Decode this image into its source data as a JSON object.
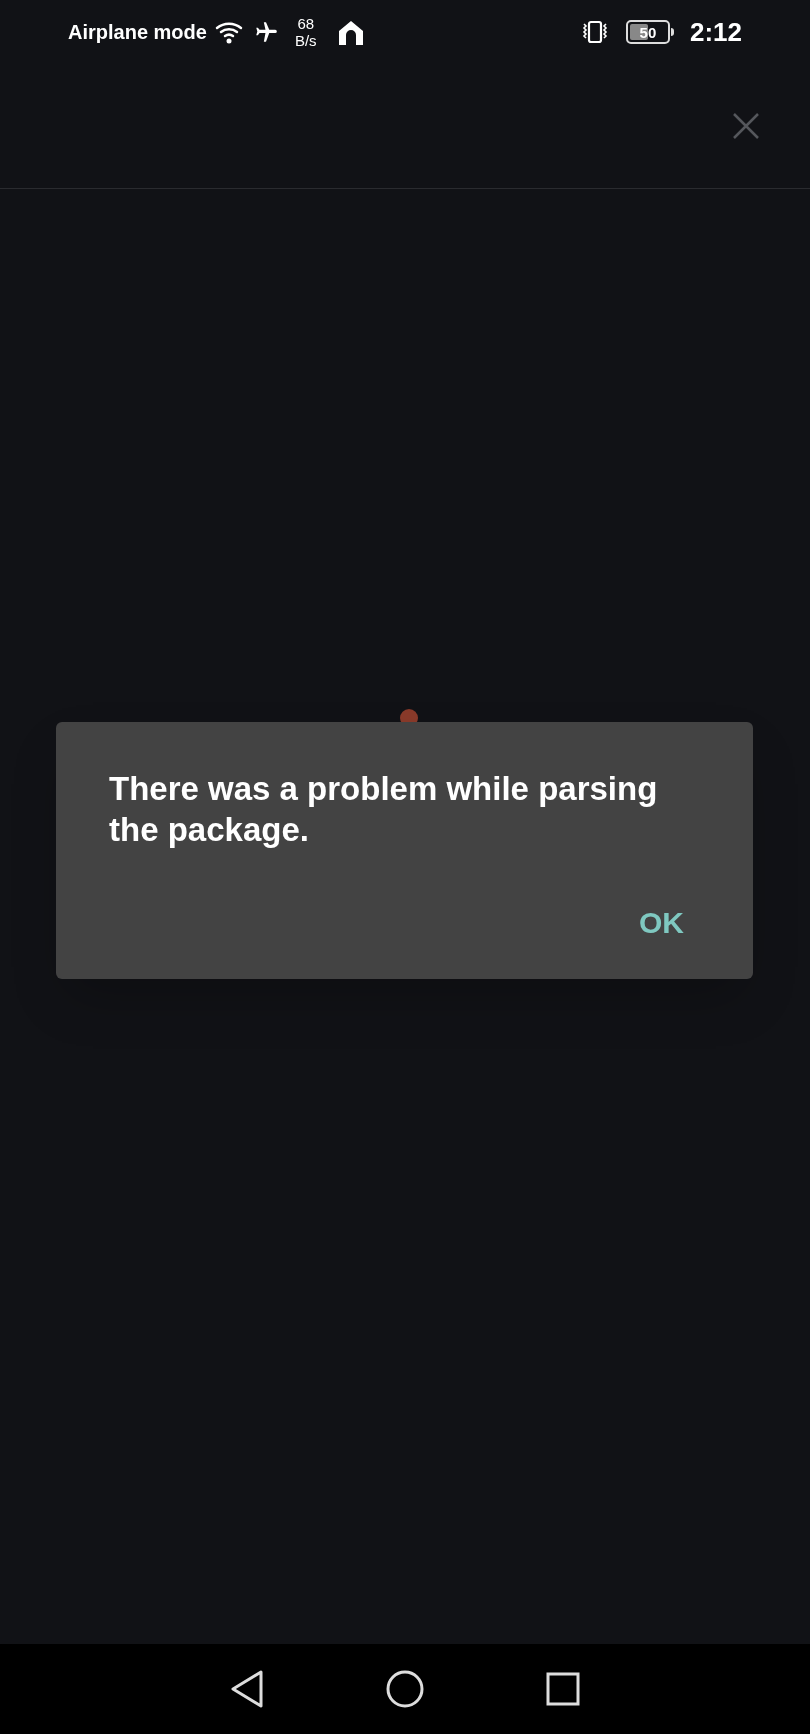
{
  "status_bar": {
    "mode": "Airplane mode",
    "speed_value": "68",
    "speed_unit": "B/s",
    "battery": "50",
    "time": "2:12"
  },
  "dialog": {
    "message": "There was a problem while parsing the package.",
    "buttons": [
      "OK"
    ]
  }
}
